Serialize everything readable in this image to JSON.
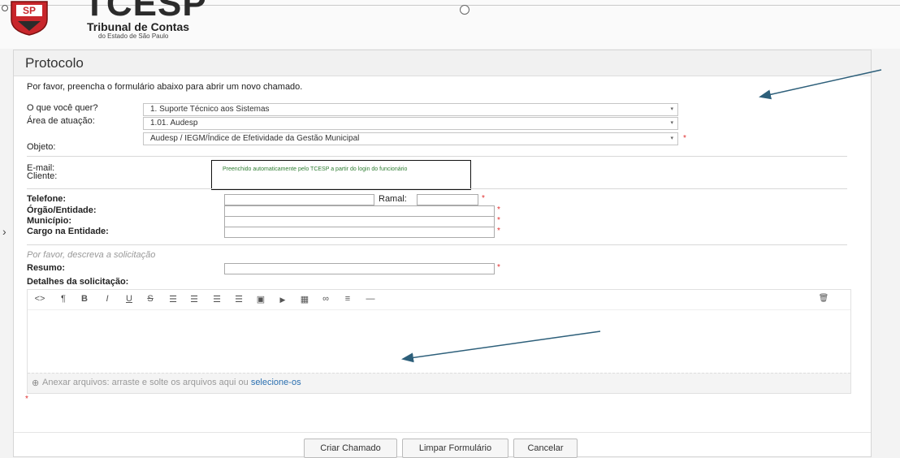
{
  "header": {
    "logo_seal_text": "SP",
    "logo_title": "TCESP",
    "logo_sub1": "Tribunal de Contas",
    "logo_sub2": "do Estado de São Paulo"
  },
  "panel": {
    "title": "Protocolo",
    "intro": "Por favor, preencha o formulário abaixo para abrir um novo chamado."
  },
  "form": {
    "o_que_label": "O que você quer?",
    "o_que_value": "1. Suporte Técnico aos Sistemas",
    "area_label": "Área de atuação:",
    "area_value": "1.01. Audesp",
    "objeto_label": "Objeto:",
    "objeto_value": "Audesp / IEGM/Índice de Efetividade da Gestão Municipal",
    "email_label": "E-mail:",
    "cliente_label": "Cliente:",
    "auto_note": "Preenchido automaticamente pelo TCESP a partir do login do funcionário",
    "telefone_label": "Telefone:",
    "ramal_label": "Ramal:",
    "orgao_label": "Órgão/Entidade:",
    "municipio_label": "Município:",
    "cargo_label": "Cargo na Entidade:",
    "descreva_hint": "Por favor, descreva a solicitação",
    "resumo_label": "Resumo:",
    "detalhes_label": "Detalhes da solicitação:",
    "required_mark": "*",
    "caret": "▾"
  },
  "editor": {
    "toolbar": {
      "code": "<>",
      "paragraph": "¶",
      "bold": "B",
      "italic": "I",
      "underline": "U",
      "strike": "S",
      "ul": "☰",
      "ol": "☰",
      "outdent": "☰",
      "indent": "☰",
      "image": "▣",
      "video": "▶",
      "table": "▦",
      "link": "∞",
      "align": "≡",
      "hr": "—",
      "trash": "🗑"
    },
    "attach_icon": "⊕",
    "attach_text": "Anexar arquivos: arraste e solte os arquivos aqui ou ",
    "attach_link": "selecione-os"
  },
  "buttons": {
    "create": "Criar Chamado",
    "clear": "Limpar Formulário",
    "cancel": "Cancelar"
  },
  "colors": {
    "arrow": "#2d5f7a",
    "required": "#e03030",
    "note_text": "#2e7d32",
    "link": "#2a6fb0"
  }
}
